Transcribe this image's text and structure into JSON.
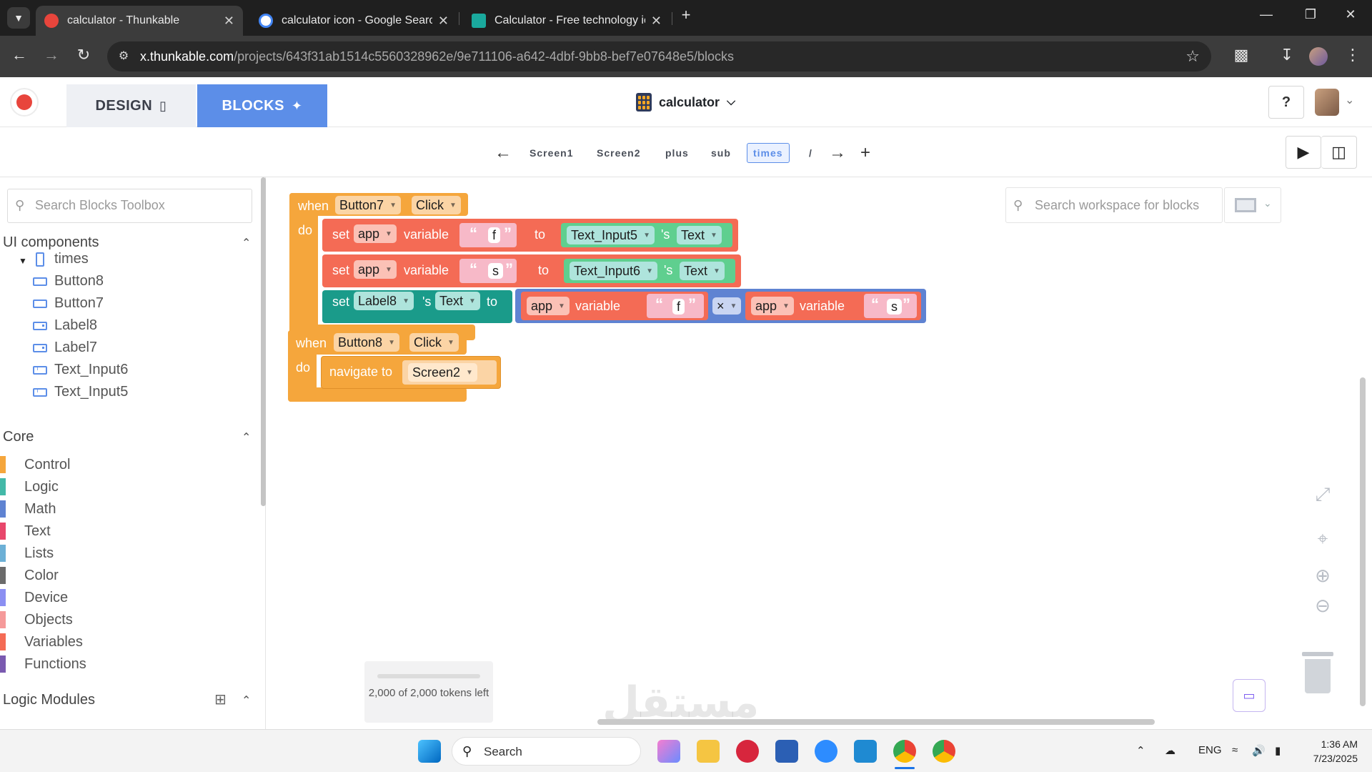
{
  "browser": {
    "tabs": [
      {
        "title": "calculator - Thunkable",
        "active": true,
        "favicon_color": "#e8453c"
      },
      {
        "title": "calculator icon - Google Search",
        "active": false,
        "favicon_color": "#4285f4"
      },
      {
        "title": "Calculator - Free technology icc",
        "active": false,
        "favicon_color": "#1aa99d"
      }
    ],
    "new_tab_label": "+",
    "url_host": "x.thunkable.com",
    "url_path": "/projects/643f31ab1514c5560328962e/9e711106-a642-4dbf-9bb8-bef7e07648e5/blocks"
  },
  "app": {
    "design_label": "DESIGN",
    "blocks_label": "BLOCKS",
    "project_name": "calculator",
    "help_label": "?"
  },
  "screens": {
    "tabs": [
      "Screen1",
      "Screen2",
      "plus",
      "sub",
      "times",
      "/"
    ],
    "active": "times"
  },
  "sidebar": {
    "search_placeholder": "Search Blocks Toolbox",
    "ui_section": "UI components",
    "screen_node": "times",
    "components": [
      "Button8",
      "Button7",
      "Label8",
      "Label7",
      "Text_Input6",
      "Text_Input5"
    ],
    "core_section": "Core",
    "core_items": [
      {
        "label": "Control",
        "color": "#f5a63c"
      },
      {
        "label": "Logic",
        "color": "#43b9a8"
      },
      {
        "label": "Math",
        "color": "#5f83d2"
      },
      {
        "label": "Text",
        "color": "#e8476b"
      },
      {
        "label": "Lists",
        "color": "#6cb0d6"
      },
      {
        "label": "Color",
        "color": "#6b6b6b"
      },
      {
        "label": "Device",
        "color": "#8b8ff2"
      },
      {
        "label": "Objects",
        "color": "#f59a9a"
      },
      {
        "label": "Variables",
        "color": "#f46b55"
      },
      {
        "label": "Functions",
        "color": "#7a5ab0"
      }
    ],
    "modules_section": "Logic Modules"
  },
  "workspace": {
    "search_placeholder": "Search workspace for blocks",
    "tokens_text": "2,000 of 2,000 tokens left",
    "blocks": {
      "when": "when",
      "do": "do",
      "set": "set",
      "to": "to",
      "variable": "variable",
      "s_text": "'s",
      "click": "Click",
      "app": "app",
      "text": "Text",
      "f": "f",
      "s": "s",
      "times_op": "×",
      "navigate_to": "navigate to",
      "button7": "Button7",
      "button8": "Button8",
      "label8": "Label8",
      "text_input5": "Text_Input5",
      "text_input6": "Text_Input6",
      "screen2": "Screen2"
    }
  },
  "taskbar": {
    "search_label": "Search",
    "lang": "ENG",
    "time": "1:36 AM",
    "date": "7/23/2025"
  },
  "watermark": "مستقل"
}
